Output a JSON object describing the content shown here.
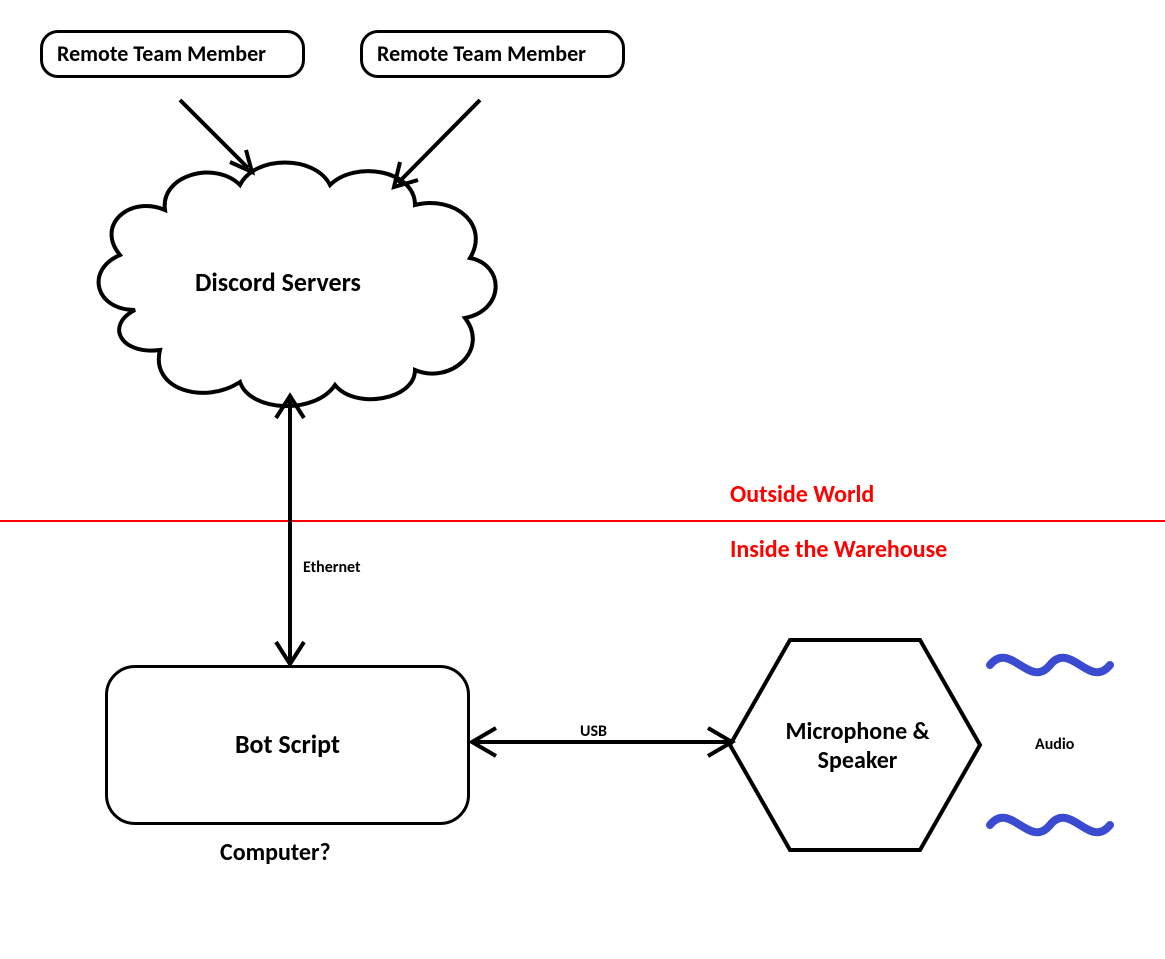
{
  "nodes": {
    "remote1": "Remote Team Member",
    "remote2": "Remote Team Member",
    "discord": "Discord Servers",
    "bot": "Bot Script",
    "mic": "Microphone & Speaker"
  },
  "edges": {
    "ethernet": "Ethernet",
    "usb": "USB"
  },
  "labels": {
    "outside": "Outside World",
    "inside": "Inside the Warehouse",
    "computer": "Computer?",
    "audio": "Audio"
  },
  "colors": {
    "divider": "#ff0000",
    "wave": "#3a4bd1"
  }
}
